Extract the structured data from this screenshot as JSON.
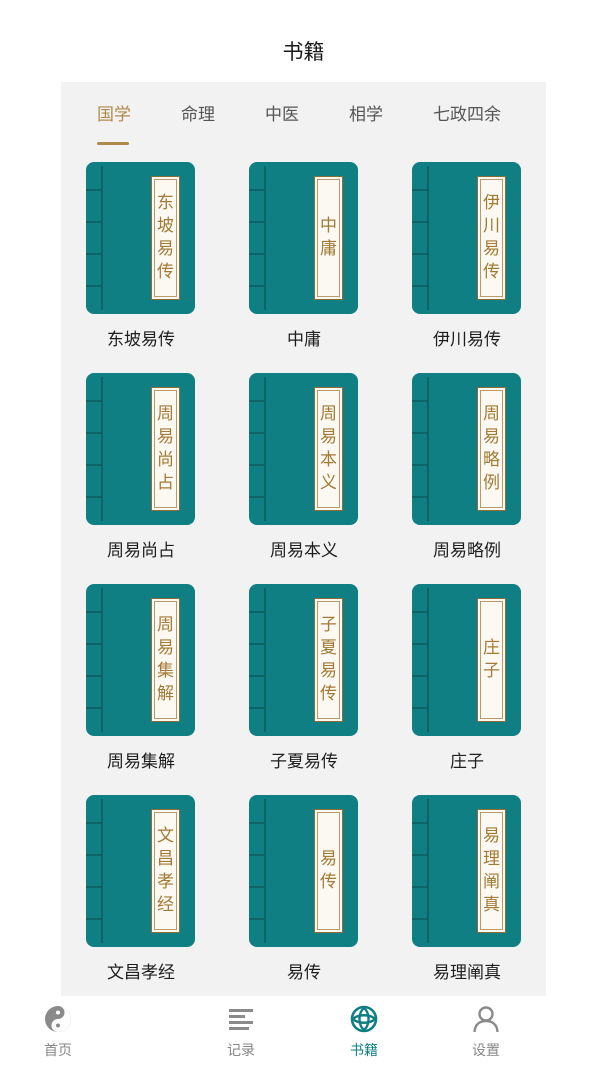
{
  "header": {
    "title": "书籍"
  },
  "tabs": [
    {
      "label": "国学",
      "active": true
    },
    {
      "label": "命理",
      "active": false
    },
    {
      "label": "中医",
      "active": false
    },
    {
      "label": "相学",
      "active": false
    },
    {
      "label": "七政四余",
      "active": false
    }
  ],
  "colors": {
    "accent": "#b08a4c",
    "book_cover": "#0f7f84",
    "book_spine_line": "#0a5d61",
    "label_text": "#a37a35",
    "nav_active": "#0f7f84"
  },
  "books": [
    {
      "title": "东坡易传",
      "cover_chars": [
        "东",
        "坡",
        "易",
        "传"
      ]
    },
    {
      "title": "中庸",
      "cover_chars": [
        "中",
        "庸"
      ]
    },
    {
      "title": "伊川易传",
      "cover_chars": [
        "伊",
        "川",
        "易",
        "传"
      ]
    },
    {
      "title": "周易尚占",
      "cover_chars": [
        "周",
        "易",
        "尚",
        "占"
      ]
    },
    {
      "title": "周易本义",
      "cover_chars": [
        "周",
        "易",
        "本",
        "义"
      ]
    },
    {
      "title": "周易略例",
      "cover_chars": [
        "周",
        "易",
        "略",
        "例"
      ]
    },
    {
      "title": "周易集解",
      "cover_chars": [
        "周",
        "易",
        "集",
        "解"
      ]
    },
    {
      "title": "子夏易传",
      "cover_chars": [
        "子",
        "夏",
        "易",
        "传"
      ]
    },
    {
      "title": "庄子",
      "cover_chars": [
        "庄",
        "子"
      ]
    },
    {
      "title": "文昌孝经",
      "cover_chars": [
        "文",
        "昌",
        "孝",
        "经"
      ]
    },
    {
      "title": "易传",
      "cover_chars": [
        "易",
        "传"
      ]
    },
    {
      "title": "易理阐真",
      "cover_chars": [
        "易",
        "理",
        "阐",
        "真"
      ]
    }
  ],
  "nav": [
    {
      "label": "首页",
      "icon": "yin-yang-icon",
      "active": false
    },
    {
      "label": "记录",
      "icon": "list-lines-icon",
      "active": false
    },
    {
      "label": "书籍",
      "icon": "book-knot-icon",
      "active": true
    },
    {
      "label": "设置",
      "icon": "user-icon",
      "active": false
    }
  ]
}
